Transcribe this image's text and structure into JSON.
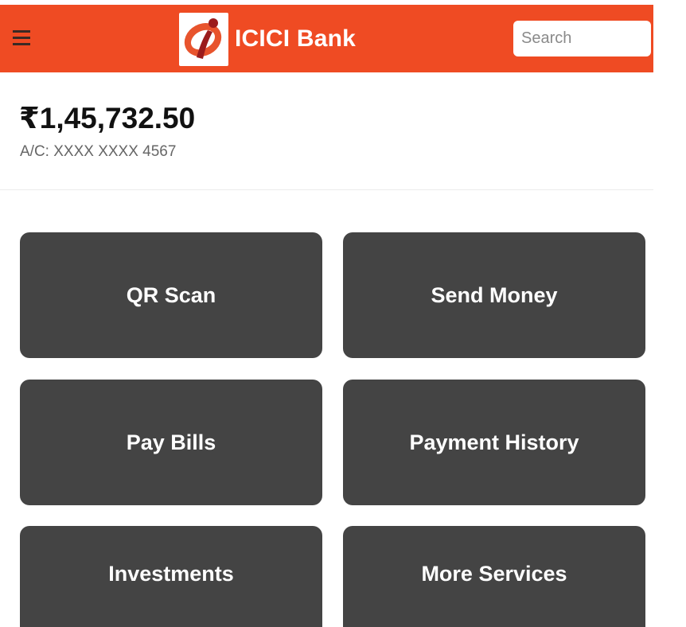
{
  "header": {
    "menu_icon": "hamburger-menu-icon",
    "brand_name": "ICICI Bank",
    "logo_icon": "icici-logo-icon",
    "search_placeholder": "Search",
    "search_value": "",
    "color": "#ef4b23"
  },
  "account": {
    "balance": "₹1,45,732.50",
    "number": "A/C: XXXX XXXX 4567"
  },
  "actions": [
    {
      "label": "QR Scan"
    },
    {
      "label": "Send Money"
    },
    {
      "label": "Pay Bills"
    },
    {
      "label": "Payment History"
    },
    {
      "label": "Investments"
    },
    {
      "label": "More Services"
    }
  ],
  "tile_color": "#444444"
}
